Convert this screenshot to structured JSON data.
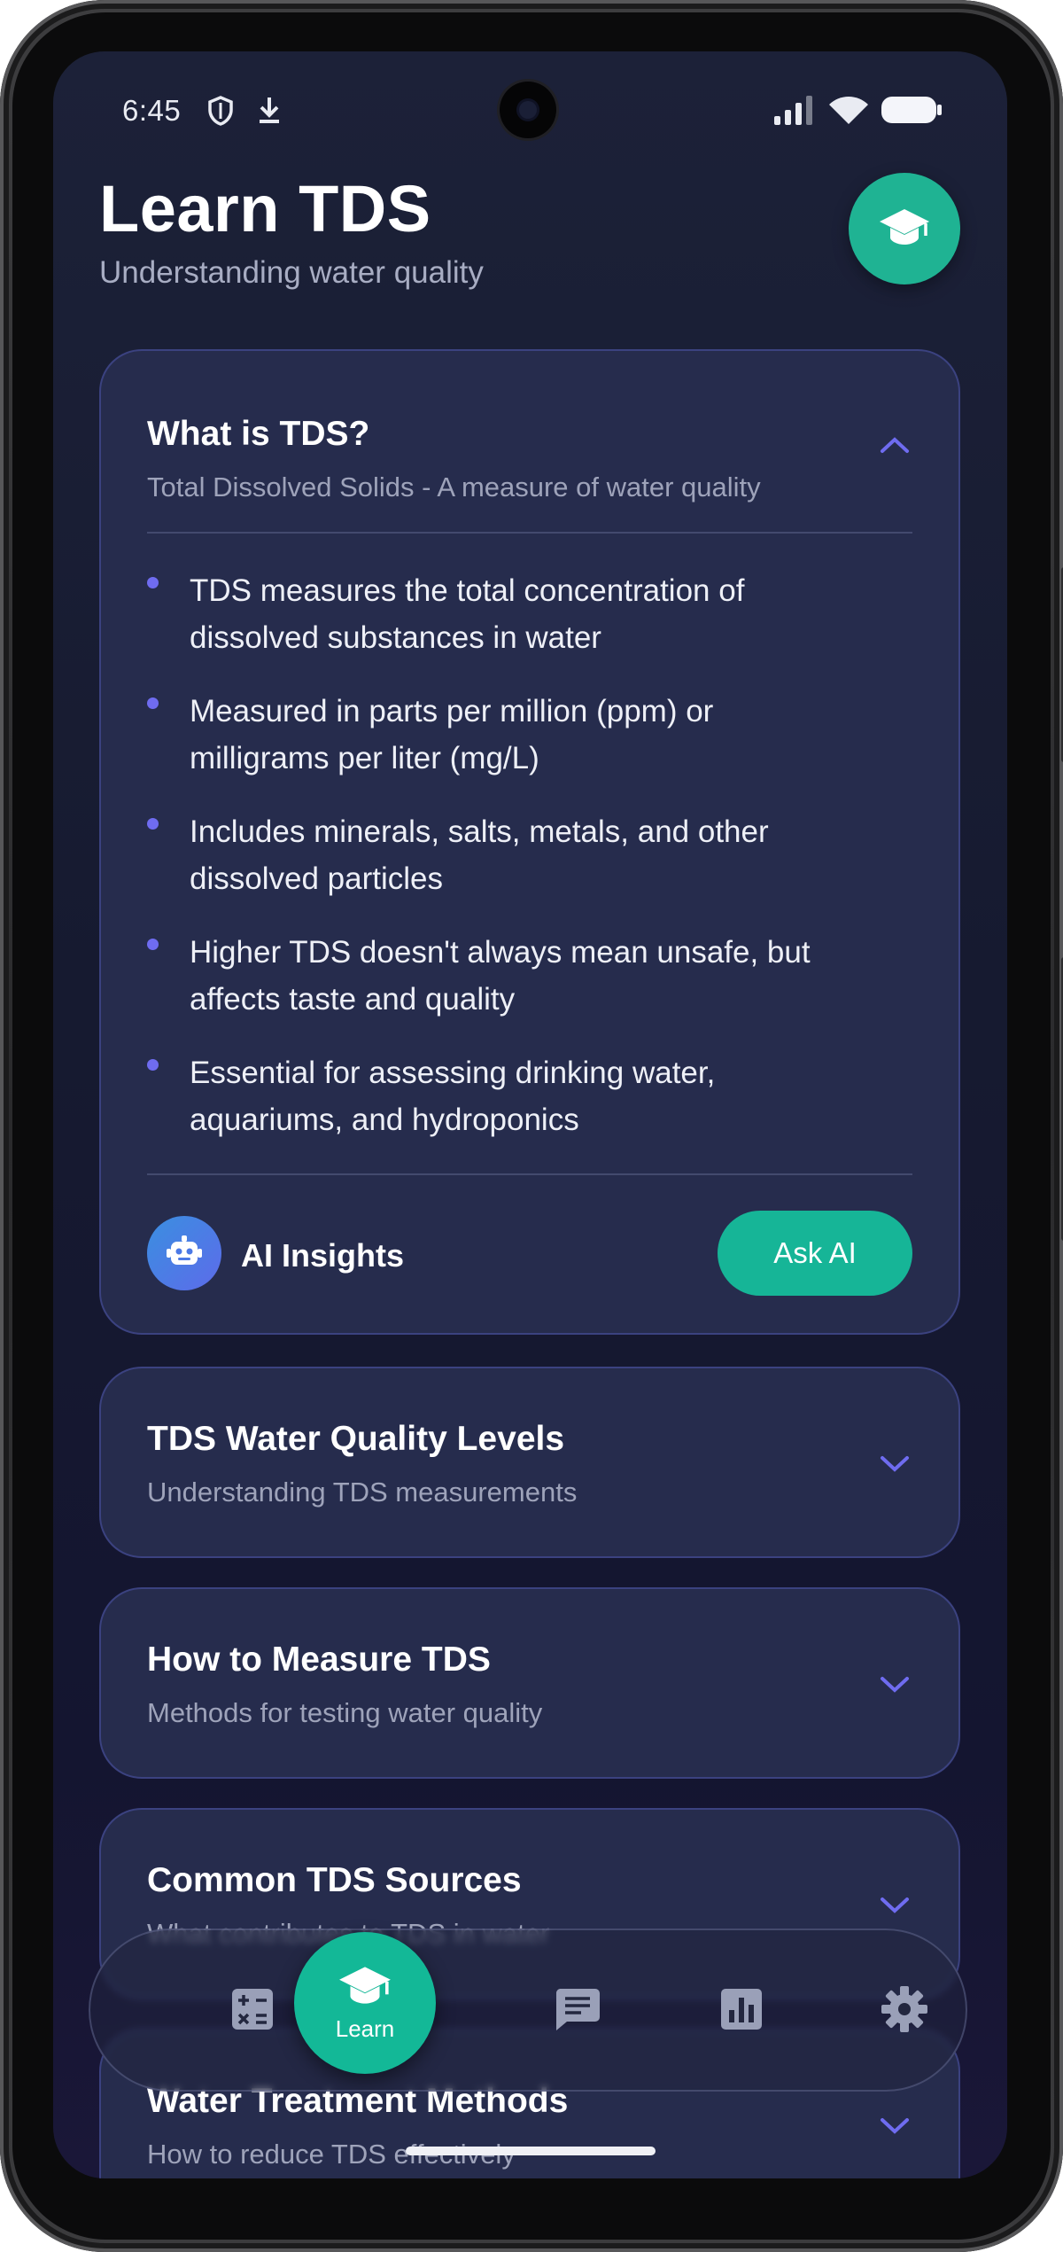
{
  "status_bar": {
    "time": "6:45",
    "icons": [
      "shield-icon",
      "download-icon",
      "signal-icon",
      "wifi-icon",
      "battery-icon"
    ]
  },
  "header": {
    "title": "Learn TDS",
    "subtitle": "Understanding water quality",
    "badge_icon": "graduation-cap-icon"
  },
  "sections": [
    {
      "title": "What is TDS?",
      "subtitle": "Total Dissolved Solids - A measure of water quality",
      "expanded": true,
      "bullets": [
        [
          "TDS measures the total concentration of",
          "dissolved substances in water"
        ],
        [
          "Measured in parts per million (ppm) or",
          "milligrams per liter (mg/L)"
        ],
        [
          "Includes minerals, salts, metals, and other",
          "dissolved particles"
        ],
        [
          "Higher TDS doesn't always mean unsafe, but",
          "affects taste and quality"
        ],
        [
          "Essential for assessing drinking water,",
          "aquariums, and hydroponics"
        ]
      ],
      "ai_label": "AI Insights",
      "ai_button": "Ask AI"
    },
    {
      "title": "TDS Water Quality Levels",
      "subtitle": "Understanding TDS measurements",
      "expanded": false
    },
    {
      "title": "How to Measure TDS",
      "subtitle": "Methods for testing water quality",
      "expanded": false
    },
    {
      "title": "Common TDS Sources",
      "subtitle": "What contributes to TDS in water",
      "expanded": false
    },
    {
      "title": "Water Treatment Methods",
      "subtitle": "How to reduce TDS effectively",
      "expanded": false
    }
  ],
  "bottom_nav": {
    "items": [
      {
        "icon": "calculator-icon",
        "label": ""
      },
      {
        "icon": "graduation-cap-icon",
        "label": "Learn",
        "active": true
      },
      {
        "icon": "chat-icon",
        "label": ""
      },
      {
        "icon": "chart-icon",
        "label": ""
      },
      {
        "icon": "settings-icon",
        "label": ""
      }
    ]
  },
  "colors": {
    "accent": "#16b597",
    "card": "#262c4d",
    "card_border": "#3b4280",
    "chevron": "#6f6cf0",
    "background": "#181c33"
  }
}
